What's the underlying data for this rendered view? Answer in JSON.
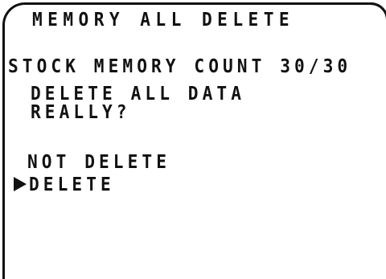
{
  "screen": {
    "title": "MEMORY ALL DELETE",
    "stock_memory_label": "STOCK MEMORY COUNT",
    "stock_memory_count": "30/30",
    "prompt_line1": "DELETE ALL DATA",
    "prompt_line2": "REALLY?",
    "options": [
      {
        "label": "NOT DELETE",
        "selected": false
      },
      {
        "label": "DELETE",
        "selected": true
      }
    ],
    "cursor_icon": "triangle-right-icon"
  }
}
